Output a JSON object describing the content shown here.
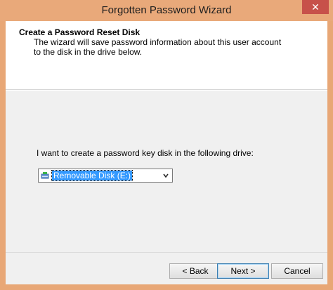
{
  "window": {
    "title": "Forgotten Password Wizard",
    "close_glyph": "✕"
  },
  "header": {
    "title": "Create a Password Reset Disk",
    "description": "The wizard will save password information about this user account to the disk in the drive below."
  },
  "main": {
    "prompt": "I want to create a password key disk in the following drive:",
    "drive_select": {
      "selected": "Removable Disk (E:)",
      "icon": "removable-drive-icon",
      "arrow_glyph": "⌄"
    }
  },
  "footer": {
    "back_label": "< Back",
    "next_label": "Next >",
    "cancel_label": "Cancel"
  }
}
